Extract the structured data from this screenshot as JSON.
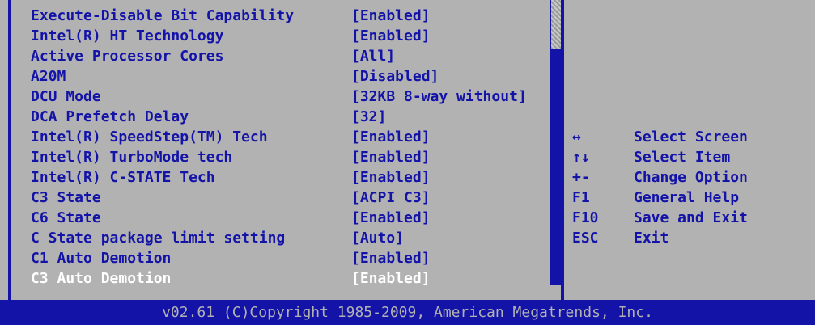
{
  "settings": [
    {
      "label": "Execute-Disable Bit Capability",
      "value": "[Enabled]"
    },
    {
      "label": "Intel(R) HT Technology",
      "value": "[Enabled]"
    },
    {
      "label": "Active Processor Cores",
      "value": "[All]"
    },
    {
      "label": "A20M",
      "value": "[Disabled]"
    },
    {
      "label": "DCU Mode",
      "value": "[32KB 8-way without]"
    },
    {
      "label": "DCA Prefetch Delay",
      "value": "[32]"
    },
    {
      "label": "Intel(R) SpeedStep(TM) Tech",
      "value": "[Enabled]"
    },
    {
      "label": "Intel(R) TurboMode tech",
      "value": "[Enabled]"
    },
    {
      "label": "Intel(R) C-STATE Tech",
      "value": "[Enabled]"
    },
    {
      "label": "C3 State",
      "value": "[ACPI C3]"
    },
    {
      "label": "C6 State",
      "value": "[Enabled]"
    },
    {
      "label": "C State package limit setting",
      "value": "[Auto]"
    },
    {
      "label": "C1 Auto Demotion",
      "value": "[Enabled]"
    },
    {
      "label": "C3 Auto Demotion",
      "value": "[Enabled]"
    }
  ],
  "help": [
    {
      "key": "↔",
      "desc": "Select Screen"
    },
    {
      "key": "↑↓",
      "desc": "Select Item"
    },
    {
      "key": "+-",
      "desc": "Change Option"
    },
    {
      "key": "F1",
      "desc": "General Help"
    },
    {
      "key": "F10",
      "desc": "Save and Exit"
    },
    {
      "key": "ESC",
      "desc": "Exit"
    }
  ],
  "footer": {
    "text": "v02.61 (C)Copyright 1985-2009, American Megatrends, Inc."
  },
  "colors": {
    "background": "#b2b2b2",
    "accent": "#1313a8",
    "selected_text": "#ffffff"
  }
}
